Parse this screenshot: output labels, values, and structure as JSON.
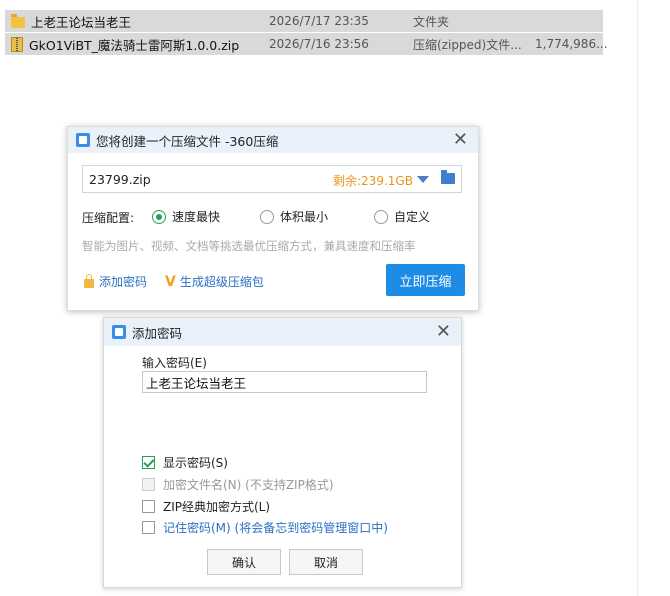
{
  "files": [
    {
      "name": "上老王论坛当老王",
      "date": "2026/7/17 23:35",
      "type": "文件夹",
      "size": "",
      "icon": "folder-icon"
    },
    {
      "name": "GkO1ViBT_魔法骑士雷阿斯1.0.0.zip",
      "date": "2026/7/16 23:56",
      "type": "压缩(zipped)文件...",
      "size": "1,774,986...",
      "icon": "zip-icon"
    }
  ],
  "compress_dialog": {
    "title": "您将创建一个压缩文件 -360压缩",
    "filename": "23799.zip",
    "free_space": "剩余:239.1GB",
    "config_label": "压缩配置:",
    "options": [
      "速度最快",
      "体积最小",
      "自定义"
    ],
    "selected_option": "速度最快",
    "hint": "智能为图片、视频、文档等挑选最优压缩方式，兼具速度和压缩率",
    "add_password": "添加密码",
    "super_compress": "生成超级压缩包",
    "compress_now": "立即压缩",
    "accent_color": "#1e8ce6"
  },
  "password_dialog": {
    "title": "添加密码",
    "input_label": "输入密码(E)",
    "password_value": "上老王论坛当老王",
    "show_password": "显示密码(S)",
    "encrypt_filename": "加密文件名(N) (不支持ZIP格式)",
    "zip_classic": "ZIP经典加密方式(L)",
    "remember_password": "记住密码(M) (将会备忘到密码管理窗口中)",
    "ok": "确认",
    "cancel": "取消",
    "show_password_checked": true
  }
}
